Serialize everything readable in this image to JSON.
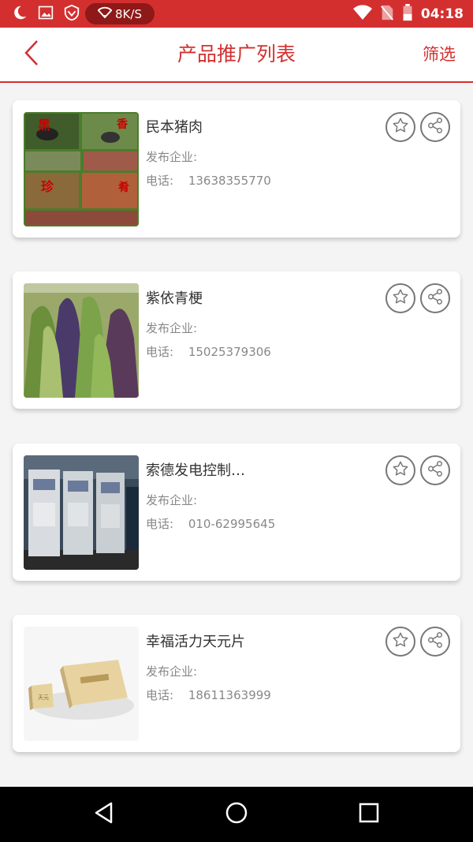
{
  "status_bar": {
    "speed": "8K/S",
    "time": "04:18"
  },
  "header": {
    "title": "产品推广列表",
    "filter_label": "筛选"
  },
  "labels": {
    "company": "发布企业:",
    "phone": "电话:"
  },
  "products": [
    {
      "name": "民本猪肉",
      "phone": "13638355770",
      "image": "pork-farm-collage"
    },
    {
      "name": "紫依青梗",
      "phone": "15025379306",
      "image": "green-vegetable"
    },
    {
      "name": "索德发电控制…",
      "phone": "010-62995645",
      "image": "power-control-cabinets"
    },
    {
      "name": "幸福活力天元片",
      "phone": "18611363999",
      "image": "supplement-box"
    }
  ],
  "colors": {
    "accent": "#d32f2f",
    "background": "#f4f4f4"
  }
}
